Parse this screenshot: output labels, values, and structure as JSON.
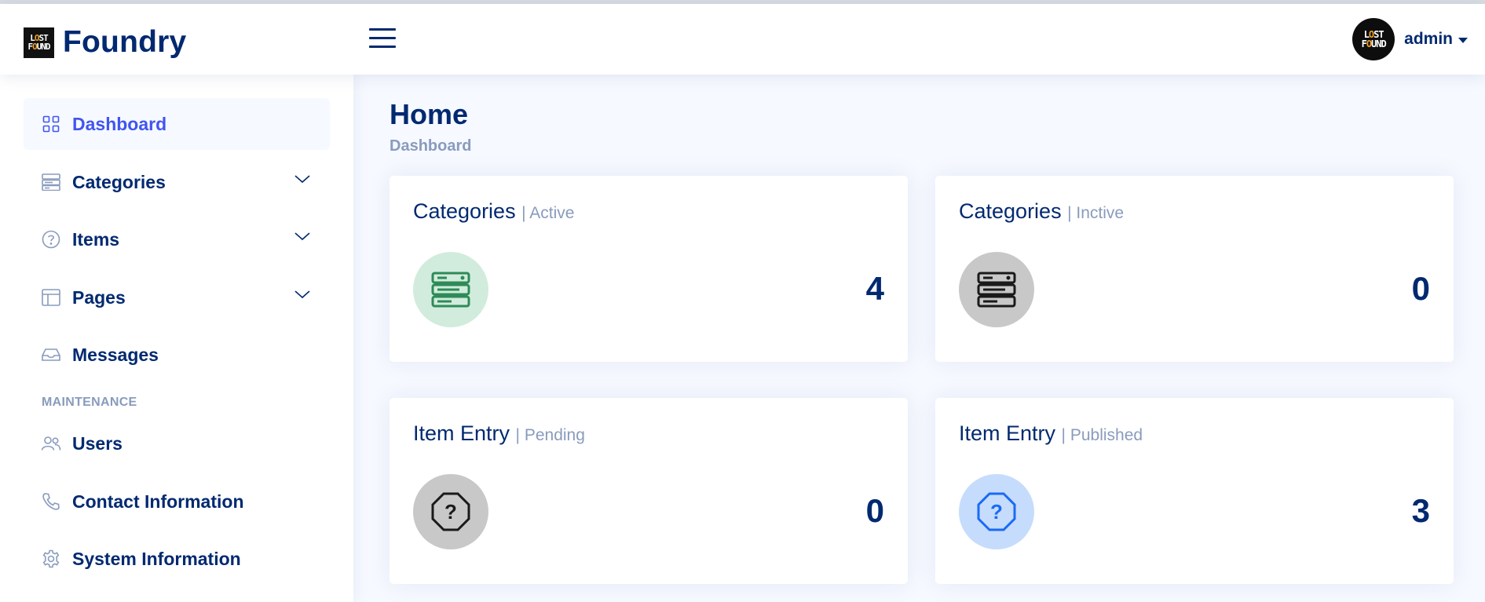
{
  "app": {
    "brand_name": "Foundry",
    "logo_text": "LOST & FOUND",
    "user_name": "admin"
  },
  "colors": {
    "primary": "#012970",
    "accent": "#4154f1",
    "muted": "#899bbd",
    "green_bg": "#d1ecdd",
    "green_icon": "#2e8b57",
    "gray_bg": "#c8c8c8",
    "blue_bg": "#c6dcfd",
    "blue_icon": "#1a6af5"
  },
  "sidebar": {
    "items": [
      {
        "label": "Dashboard",
        "icon": "grid-icon",
        "active": true
      },
      {
        "label": "Categories",
        "icon": "server-icon",
        "has_children": true
      },
      {
        "label": "Items",
        "icon": "question-circle-icon",
        "has_children": true
      },
      {
        "label": "Pages",
        "icon": "layout-icon",
        "has_children": true
      },
      {
        "label": "Messages",
        "icon": "inbox-icon"
      }
    ],
    "heading": "MAINTENANCE",
    "maintenance_items": [
      {
        "label": "Users",
        "icon": "people-icon"
      },
      {
        "label": "Contact Information",
        "icon": "telephone-icon"
      },
      {
        "label": "System Information",
        "icon": "gear-icon"
      }
    ]
  },
  "page": {
    "title": "Home",
    "breadcrumb": "Dashboard"
  },
  "cards": [
    {
      "title": "Categories",
      "subtitle": "| Active",
      "value": "4",
      "icon": "server-icon",
      "theme": "green"
    },
    {
      "title": "Categories",
      "subtitle": "| Inctive",
      "value": "0",
      "icon": "server-icon",
      "theme": "gray"
    },
    {
      "title": "Item Entry",
      "subtitle": "| Pending",
      "value": "0",
      "icon": "question-octagon-icon",
      "theme": "gray"
    },
    {
      "title": "Item Entry",
      "subtitle": "| Published",
      "value": "3",
      "icon": "question-octagon-icon",
      "theme": "blue"
    }
  ]
}
